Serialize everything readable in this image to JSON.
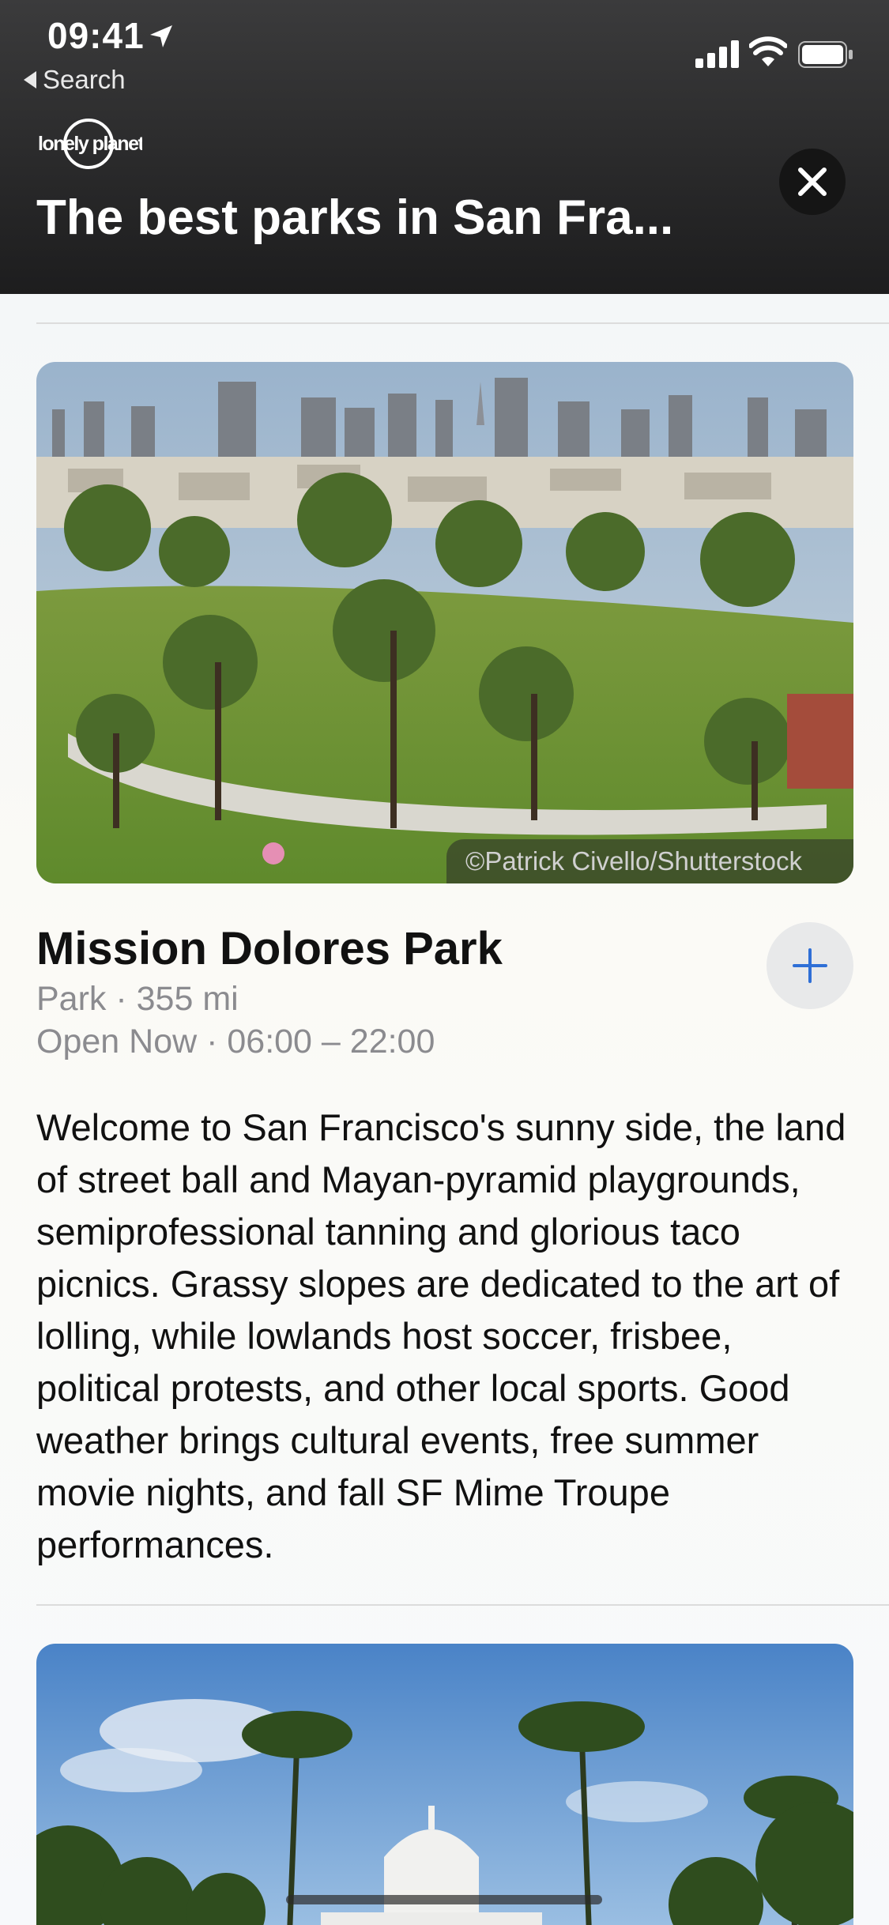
{
  "status_bar": {
    "time": "09:41"
  },
  "nav": {
    "back_label": "Search"
  },
  "brand": {
    "logo_text": "lonely planet"
  },
  "header": {
    "title": "The best parks in San Fra..."
  },
  "place": {
    "photo_credit": "©Patrick Civello/Shutterstock",
    "name": "Mission Dolores Park",
    "meta_line_1": "Park · 355 mi",
    "meta_line_2": "Open Now · 06:00 – 22:00",
    "description": "Welcome to San Francisco's sunny side, the land of street ball and Mayan-pyramid playgrounds, semiprofessional tanning and glorious taco picnics. Grassy slopes are dedicated to the art of lolling, while lowlands host soccer, frisbee, political protests, and other local sports. Good weather brings cultural events, free summer movie nights, and fall SF Mime Troupe performances."
  },
  "colors": {
    "accent": "#2f6fd6",
    "header_bg": "#2a2a2b",
    "secondary_text": "#8b8b8f"
  }
}
